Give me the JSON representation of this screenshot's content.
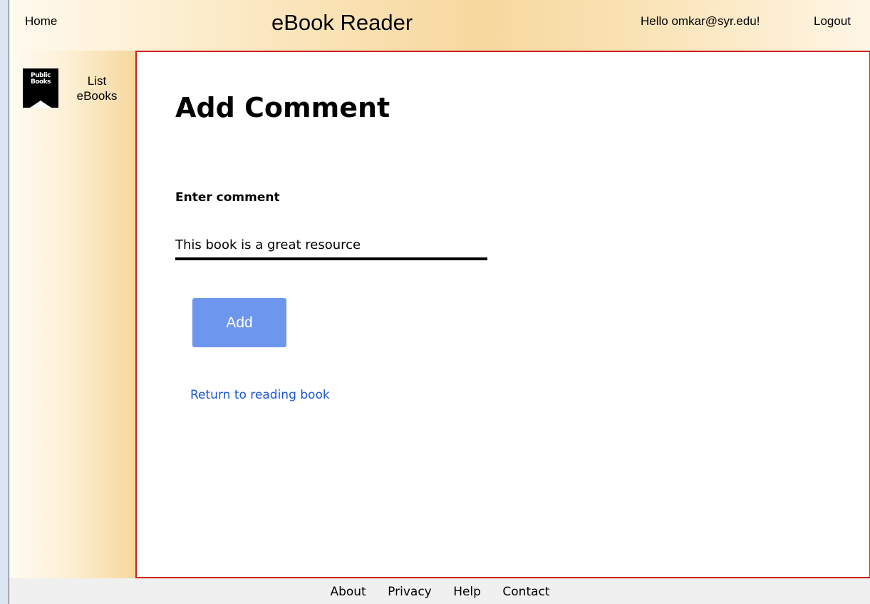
{
  "header": {
    "home_label": "Home",
    "title": "eBook Reader",
    "greeting": "Hello omkar@syr.edu!",
    "logout_label": "Logout"
  },
  "sidebar": {
    "logo_text": "Public Books",
    "list_label": "List eBooks"
  },
  "main": {
    "page_title": "Add Comment",
    "field_label": "Enter comment",
    "comment_value": "This book is a great resource",
    "add_button_label": "Add",
    "return_link_label": "Return to reading book"
  },
  "footer": {
    "links": [
      "About",
      "Privacy",
      "Help",
      "Contact"
    ]
  },
  "colors": {
    "content_border": "#cc2222",
    "button_bg": "#6d96ee",
    "link": "#1a56d6",
    "header_accent": "#f7d89e"
  }
}
